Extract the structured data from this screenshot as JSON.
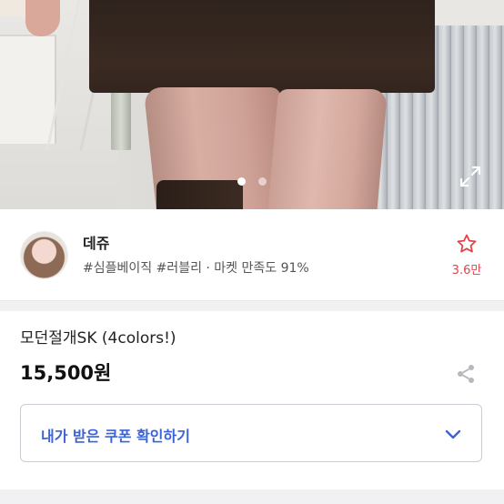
{
  "gallery": {
    "page_count": 2,
    "active_index": 0
  },
  "seller": {
    "name": "데쥬",
    "tags": "#심플베이직 #러블리 · 마켓 만족도 91%",
    "favorite_count": "3.6만"
  },
  "product": {
    "title": "모던절개SK (4colors!)",
    "price": "15,500원"
  },
  "coupon": {
    "label": "내가 받은 쿠폰 확인하기"
  },
  "colors": {
    "accent_blue": "#3b63d8",
    "favorite_red": "#e0434a"
  },
  "icons": [
    "expand-icon",
    "star-icon",
    "share-icon",
    "chevron-down-icon"
  ]
}
